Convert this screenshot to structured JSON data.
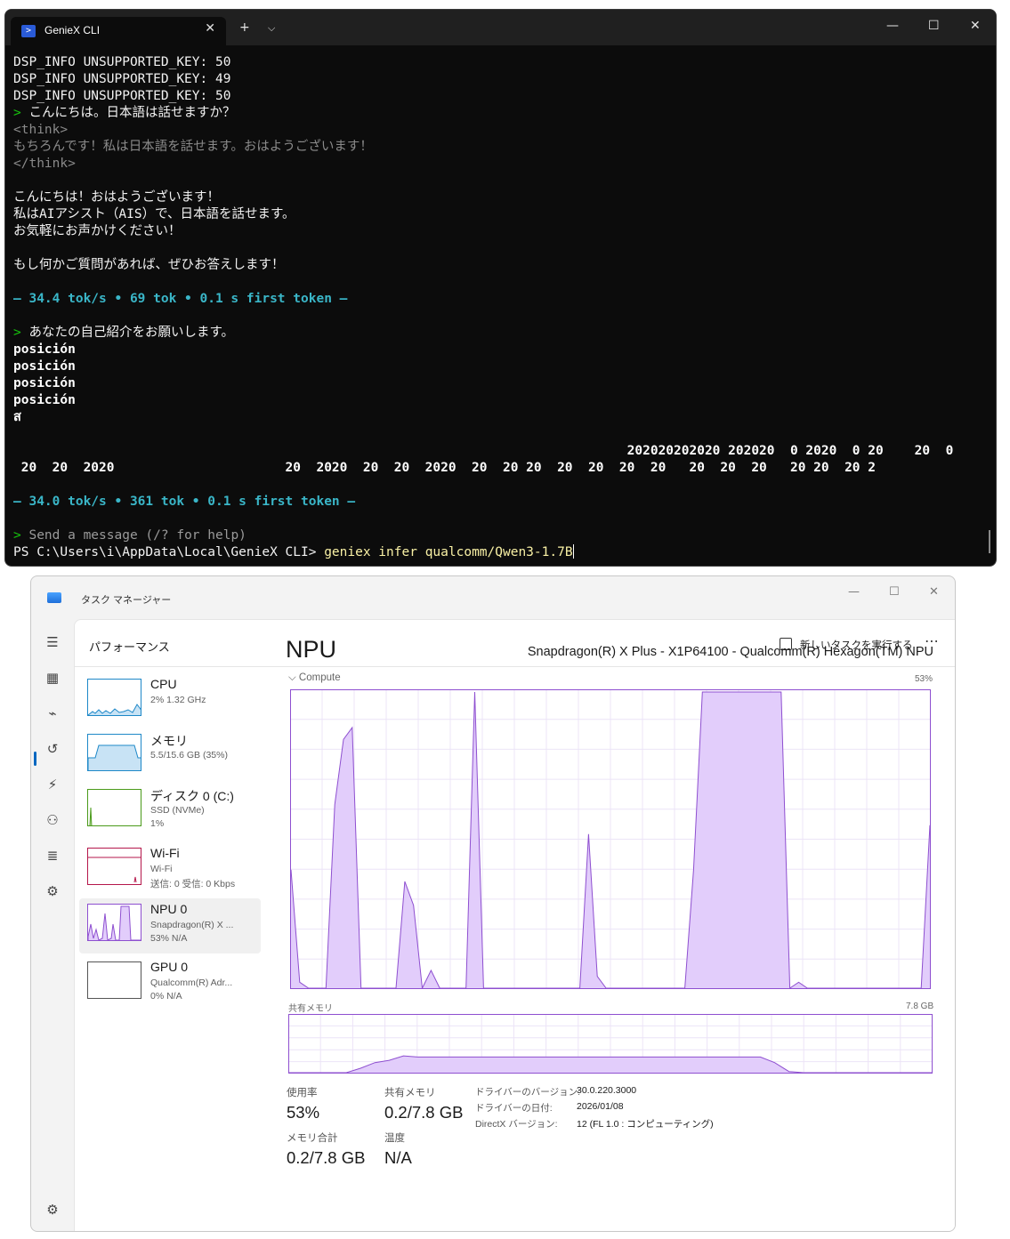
{
  "terminal": {
    "tab_title": "GenieX CLI",
    "icon_name": "powershell-icon",
    "lines": [
      {
        "cls": "c-bright",
        "text": "DSP_INFO UNSUPPORTED_KEY: 50"
      },
      {
        "cls": "c-bright",
        "text": "DSP_INFO UNSUPPORTED_KEY: 49"
      },
      {
        "cls": "c-bright",
        "text": "DSP_INFO UNSUPPORTED_KEY: 50"
      },
      {
        "cls": "c-prompt",
        "prompt": "> ",
        "text": "こんにちは。日本語は話せますか？"
      },
      {
        "cls": "c-gray",
        "text": "<think>"
      },
      {
        "cls": "c-gray",
        "text": "もちろんです！私は日本語を話せます。おはようございます！"
      },
      {
        "cls": "c-gray",
        "text": "</think>"
      },
      {
        "cls": "c-bright",
        "text": ""
      },
      {
        "cls": "c-bright",
        "text": "こんにちは！おはようございます！"
      },
      {
        "cls": "c-bright",
        "text": "私はAIアシスト（AIS）で、日本語を話せます。"
      },
      {
        "cls": "c-bright",
        "text": "お気軽にお声かけください！"
      },
      {
        "cls": "c-bright",
        "text": ""
      },
      {
        "cls": "c-bright",
        "text": "もし何かご質問があれば、ぜひお答えします！"
      },
      {
        "cls": "c-bright",
        "text": ""
      },
      {
        "cls": "c-cyan",
        "text": "— 34.4 tok/s • 69 tok • 0.1 s first token —"
      },
      {
        "cls": "c-bright",
        "text": ""
      },
      {
        "cls": "c-prompt",
        "prompt": "> ",
        "text": "あなたの自己紹介をお願いします。"
      },
      {
        "cls": "c-bold",
        "text": "posición"
      },
      {
        "cls": "c-bold",
        "text": "posición"
      },
      {
        "cls": "c-bold",
        "text": "posición"
      },
      {
        "cls": "c-bold",
        "text": "posición"
      },
      {
        "cls": "c-bold",
        "text": "ส"
      },
      {
        "cls": "c-bold",
        "text": ""
      },
      {
        "cls": "c-bold",
        "text": "                                                                               202020202020 202020  0 2020  0 20    20  0"
      },
      {
        "cls": "c-bold",
        "text": " 20  20  2020                      20  2020  20  20  2020  20  20 20  20  20  20  20   20  20  20   20 20  20 2"
      },
      {
        "cls": "c-bright",
        "text": ""
      },
      {
        "cls": "c-cyan",
        "text": "— 34.0 tok/s • 361 tok • 0.1 s first token —"
      },
      {
        "cls": "c-bright",
        "text": ""
      },
      {
        "cls": "c-placeholder",
        "prompt": "> ",
        "text": "Send a message (/? for help)"
      },
      {
        "cls": "c-ps",
        "text": "PS C:\\Users\\i\\AppData\\Local\\GenieX CLI> ",
        "cmd": "geniex infer qualcomm/Qwen3-1.7B"
      }
    ]
  },
  "taskmanager": {
    "title": "タスク マネージャー",
    "page_title": "パフォーマンス",
    "new_task_label": "新しいタスクを実行する",
    "resources": [
      {
        "name": "CPU",
        "sub1": "2%  1.32 GHz",
        "sub2": "",
        "color": "#1e88c8"
      },
      {
        "name": "メモリ",
        "sub1": "5.5/15.6 GB (35%)",
        "sub2": "",
        "color": "#1e88c8"
      },
      {
        "name": "ディスク 0 (C:)",
        "sub1": "SSD (NVMe)",
        "sub2": "1%",
        "color": "#4a9a1a"
      },
      {
        "name": "Wi-Fi",
        "sub1": "Wi-Fi",
        "sub2": "送信: 0 受信: 0 Kbps",
        "color": "#b5174b"
      },
      {
        "name": "NPU 0",
        "sub1": "Snapdragon(R) X ...",
        "sub2": "53%  N/A",
        "color": "#8e4fd0"
      },
      {
        "name": "GPU 0",
        "sub1": "Qualcomm(R) Adr...",
        "sub2": "0%  N/A",
        "color": "#555555"
      }
    ],
    "npu": {
      "title": "NPU",
      "device": "Snapdragon(R) X Plus - X1P64100 - Qualcomm(R) Hexagon(TM) NPU",
      "compute_label": "Compute",
      "compute_pct": "53%",
      "shared_label": "共有メモリ",
      "shared_max": "7.8 GB",
      "compute_series": [
        40,
        2,
        0,
        0,
        0,
        62,
        84,
        88,
        0,
        0,
        0,
        0,
        0,
        36,
        28,
        0,
        6,
        0,
        0,
        0,
        0,
        100,
        0,
        0,
        0,
        0,
        0,
        0,
        0,
        0,
        0,
        0,
        0,
        0,
        52,
        4,
        0,
        0,
        0,
        0,
        0,
        0,
        0,
        0,
        0,
        0,
        40,
        100,
        100,
        100,
        100,
        100,
        100,
        100,
        100,
        100,
        100,
        0,
        2,
        0,
        0,
        0,
        0,
        0,
        0,
        0,
        0,
        0,
        0,
        0,
        0,
        0,
        0,
        55
      ],
      "shared_series": [
        0,
        0,
        0,
        0,
        0,
        8,
        18,
        22,
        30,
        28,
        28,
        28,
        28,
        28,
        28,
        28,
        28,
        28,
        28,
        28,
        28,
        28,
        28,
        28,
        28,
        28,
        28,
        28,
        28,
        28,
        28,
        28,
        28,
        28,
        18,
        2,
        0,
        0,
        0,
        0,
        0,
        0,
        0,
        0,
        0,
        0
      ],
      "stats": {
        "util_label": "使用率",
        "util_value": "53%",
        "shared_label": "共有メモリ",
        "shared_value": "0.2/7.8 GB",
        "memtotal_label": "メモリ合計",
        "memtotal_value": "0.2/7.8 GB",
        "temp_label": "温度",
        "temp_value": "N/A"
      },
      "driver": {
        "version_label": "ドライバーのバージョン:",
        "version_value": "30.0.220.3000",
        "date_label": "ドライバーの日付:",
        "date_value": "2026/01/08",
        "directx_label": "DirectX バージョン:",
        "directx_value": "12 (FL 1.0 : コンピューティング)"
      }
    },
    "accent": "#8e4fd0",
    "fill": "#e2cdfb"
  }
}
